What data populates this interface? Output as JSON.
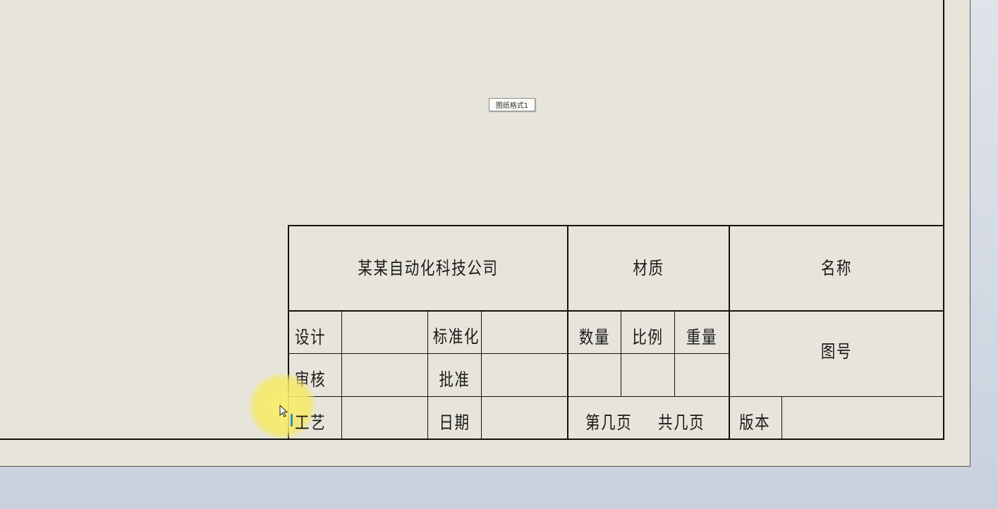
{
  "sheet": {
    "format_label": "图纸格式1"
  },
  "title_block": {
    "company": "某某自动化科技公司",
    "material": "材质",
    "name": "名称",
    "design": "设计",
    "standardization": "标准化",
    "review": "审核",
    "approval": "批准",
    "process": "工艺",
    "date": "日期",
    "quantity": "数量",
    "scale": "比例",
    "weight": "重量",
    "drawing_number": "图号",
    "page_of": "第几页",
    "total_pages": "共几页",
    "version": "版本"
  },
  "colors": {
    "sheet": "#e7e5db",
    "lines": "#111111",
    "highlight": "#f6e864",
    "caret": "#2b8fd0"
  }
}
